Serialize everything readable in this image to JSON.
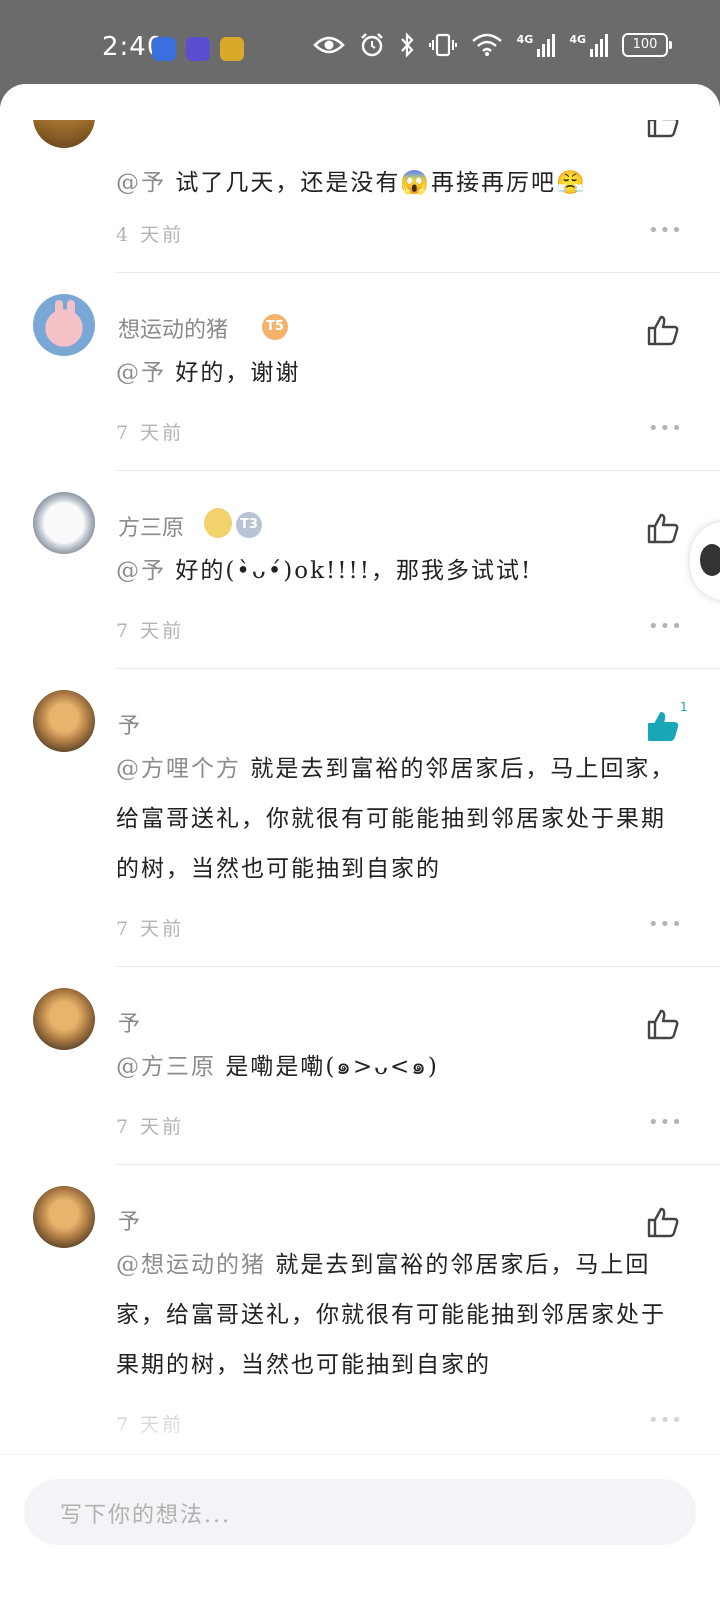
{
  "status_bar": {
    "time": "2:40",
    "signal1_label": "4G",
    "signal2_label": "4G",
    "battery": "100",
    "colors": {
      "app1": "#3b6fe0",
      "app2": "#5a4fd0",
      "app3": "#d8a92a"
    }
  },
  "comments": [
    {
      "username": "",
      "mention": "@予",
      "text": "试了几天，还是没有😱再接再厉吧😤",
      "time": "4 天前",
      "more": "•••"
    },
    {
      "username": "想运动的猪",
      "badge": "T5",
      "mention": "@予",
      "text": "好的，谢谢",
      "time": "7 天前",
      "more": "•••"
    },
    {
      "username": "方三原",
      "badge": "T3",
      "mention": "@予",
      "text": "好的(•̀ᴗ•́)ok!!!!，那我多试试!",
      "time": "7 天前",
      "more": "•••"
    },
    {
      "username": "予",
      "like_count": "1",
      "liked": true,
      "mention": "@方哩个方",
      "text": "就是去到富裕的邻居家后，马上回家，给富哥送礼，你就很有可能能抽到邻居家处于果期的树，当然也可能抽到自家的",
      "time": "7 天前",
      "more": "•••"
    },
    {
      "username": "予",
      "mention": "@方三原",
      "text": "是嘞是嘞(๑>ᴗ<๑)",
      "time": "7 天前",
      "more": "•••"
    },
    {
      "username": "予",
      "mention": "@想运动的猪",
      "text": "就是去到富裕的邻居家后，马上回家，给富哥送礼，你就很有可能能抽到邻居家处于果期的树，当然也可能抽到自家的",
      "time": "7 天前",
      "more": "•••"
    }
  ],
  "input": {
    "placeholder": "写下你的想法..."
  },
  "colors": {
    "like_active": "#19a7b8",
    "like_inactive": "#444444",
    "badge_t5": "#f3b36a",
    "badge_t3": "#b8c4d6"
  }
}
